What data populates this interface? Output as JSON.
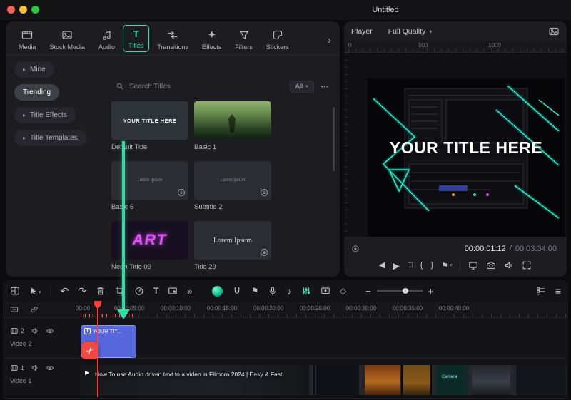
{
  "window": {
    "title": "Untitled"
  },
  "colors": {
    "accent": "#2ce3a6",
    "clip_blue": "#5666dd",
    "playhead_red": "#ff3c35",
    "neon_purple": "#e44ff0"
  },
  "glyphs": {
    "chevron_right": "›",
    "caret_down": "▾",
    "side_chevron": "▸",
    "dots": "•••",
    "undo": "↶",
    "redo": "↷",
    "more": "»",
    "text_tool": "T",
    "marker_flag": "⚑",
    "beat_note": "♪",
    "keyframe": "◇",
    "zoom_out": "−",
    "zoom_in": "+",
    "menu": "≡",
    "step_back": "◀",
    "play": "▶",
    "stop": "□",
    "mark_in": "{",
    "mark_out": "}",
    "scissors": "✂",
    "titles_tab_icon": "T",
    "clip_play": "▶"
  },
  "tabs": [
    {
      "label": "Media"
    },
    {
      "label": "Stock Media"
    },
    {
      "label": "Audio"
    },
    {
      "label": "Titles",
      "selected": true
    },
    {
      "label": "Transitions"
    },
    {
      "label": "Effects"
    },
    {
      "label": "Filters"
    },
    {
      "label": "Stickers"
    }
  ],
  "sidebar": {
    "items": [
      {
        "label": "Mine"
      },
      {
        "label": "Trending",
        "selected": true
      },
      {
        "label": "Title Effects"
      },
      {
        "label": "Title Templates"
      }
    ]
  },
  "library": {
    "search": {
      "placeholder": "Search Titles",
      "filter": "All"
    },
    "cards": [
      {
        "name": "Default Title",
        "thumb_text": "YOUR TITLE HERE"
      },
      {
        "name": "Basic 1",
        "thumb_text": ""
      },
      {
        "name": "Basic 6",
        "thumb_text": "Lorem Ipsum"
      },
      {
        "name": "Subtitle 2",
        "thumb_text": "Lorem ipsum"
      },
      {
        "name": "Neon Title 09",
        "thumb_text": "ART"
      },
      {
        "name": "Title 29",
        "thumb_text": "Lorem Ipsum"
      }
    ]
  },
  "player": {
    "label": "Player",
    "quality": "Full Quality",
    "ruler": [
      "0",
      "500",
      "1000"
    ],
    "preview_title": "YOUR TITLE HERE",
    "current_time": "00:00:01:12",
    "time_separator": "/",
    "total_time": "00:03:34:00"
  },
  "timeline": {
    "ruler": [
      "00:00",
      "00:00:05:00",
      "00:00:10:00",
      "00:00:15:00",
      "00:00:20:00",
      "00:00:25:00",
      "00:00:30:00",
      "00:00:35:00",
      "00:00:40:00"
    ],
    "tracks": [
      {
        "number": "2",
        "name": "Video 2",
        "clip_label": "YOUR TIT..."
      },
      {
        "number": "1",
        "name": "Video 1",
        "clip_text": "How To use Audio driven text to a video in Filmora 2024 | Easy & Fast",
        "strip_label": "Camera"
      }
    ]
  }
}
